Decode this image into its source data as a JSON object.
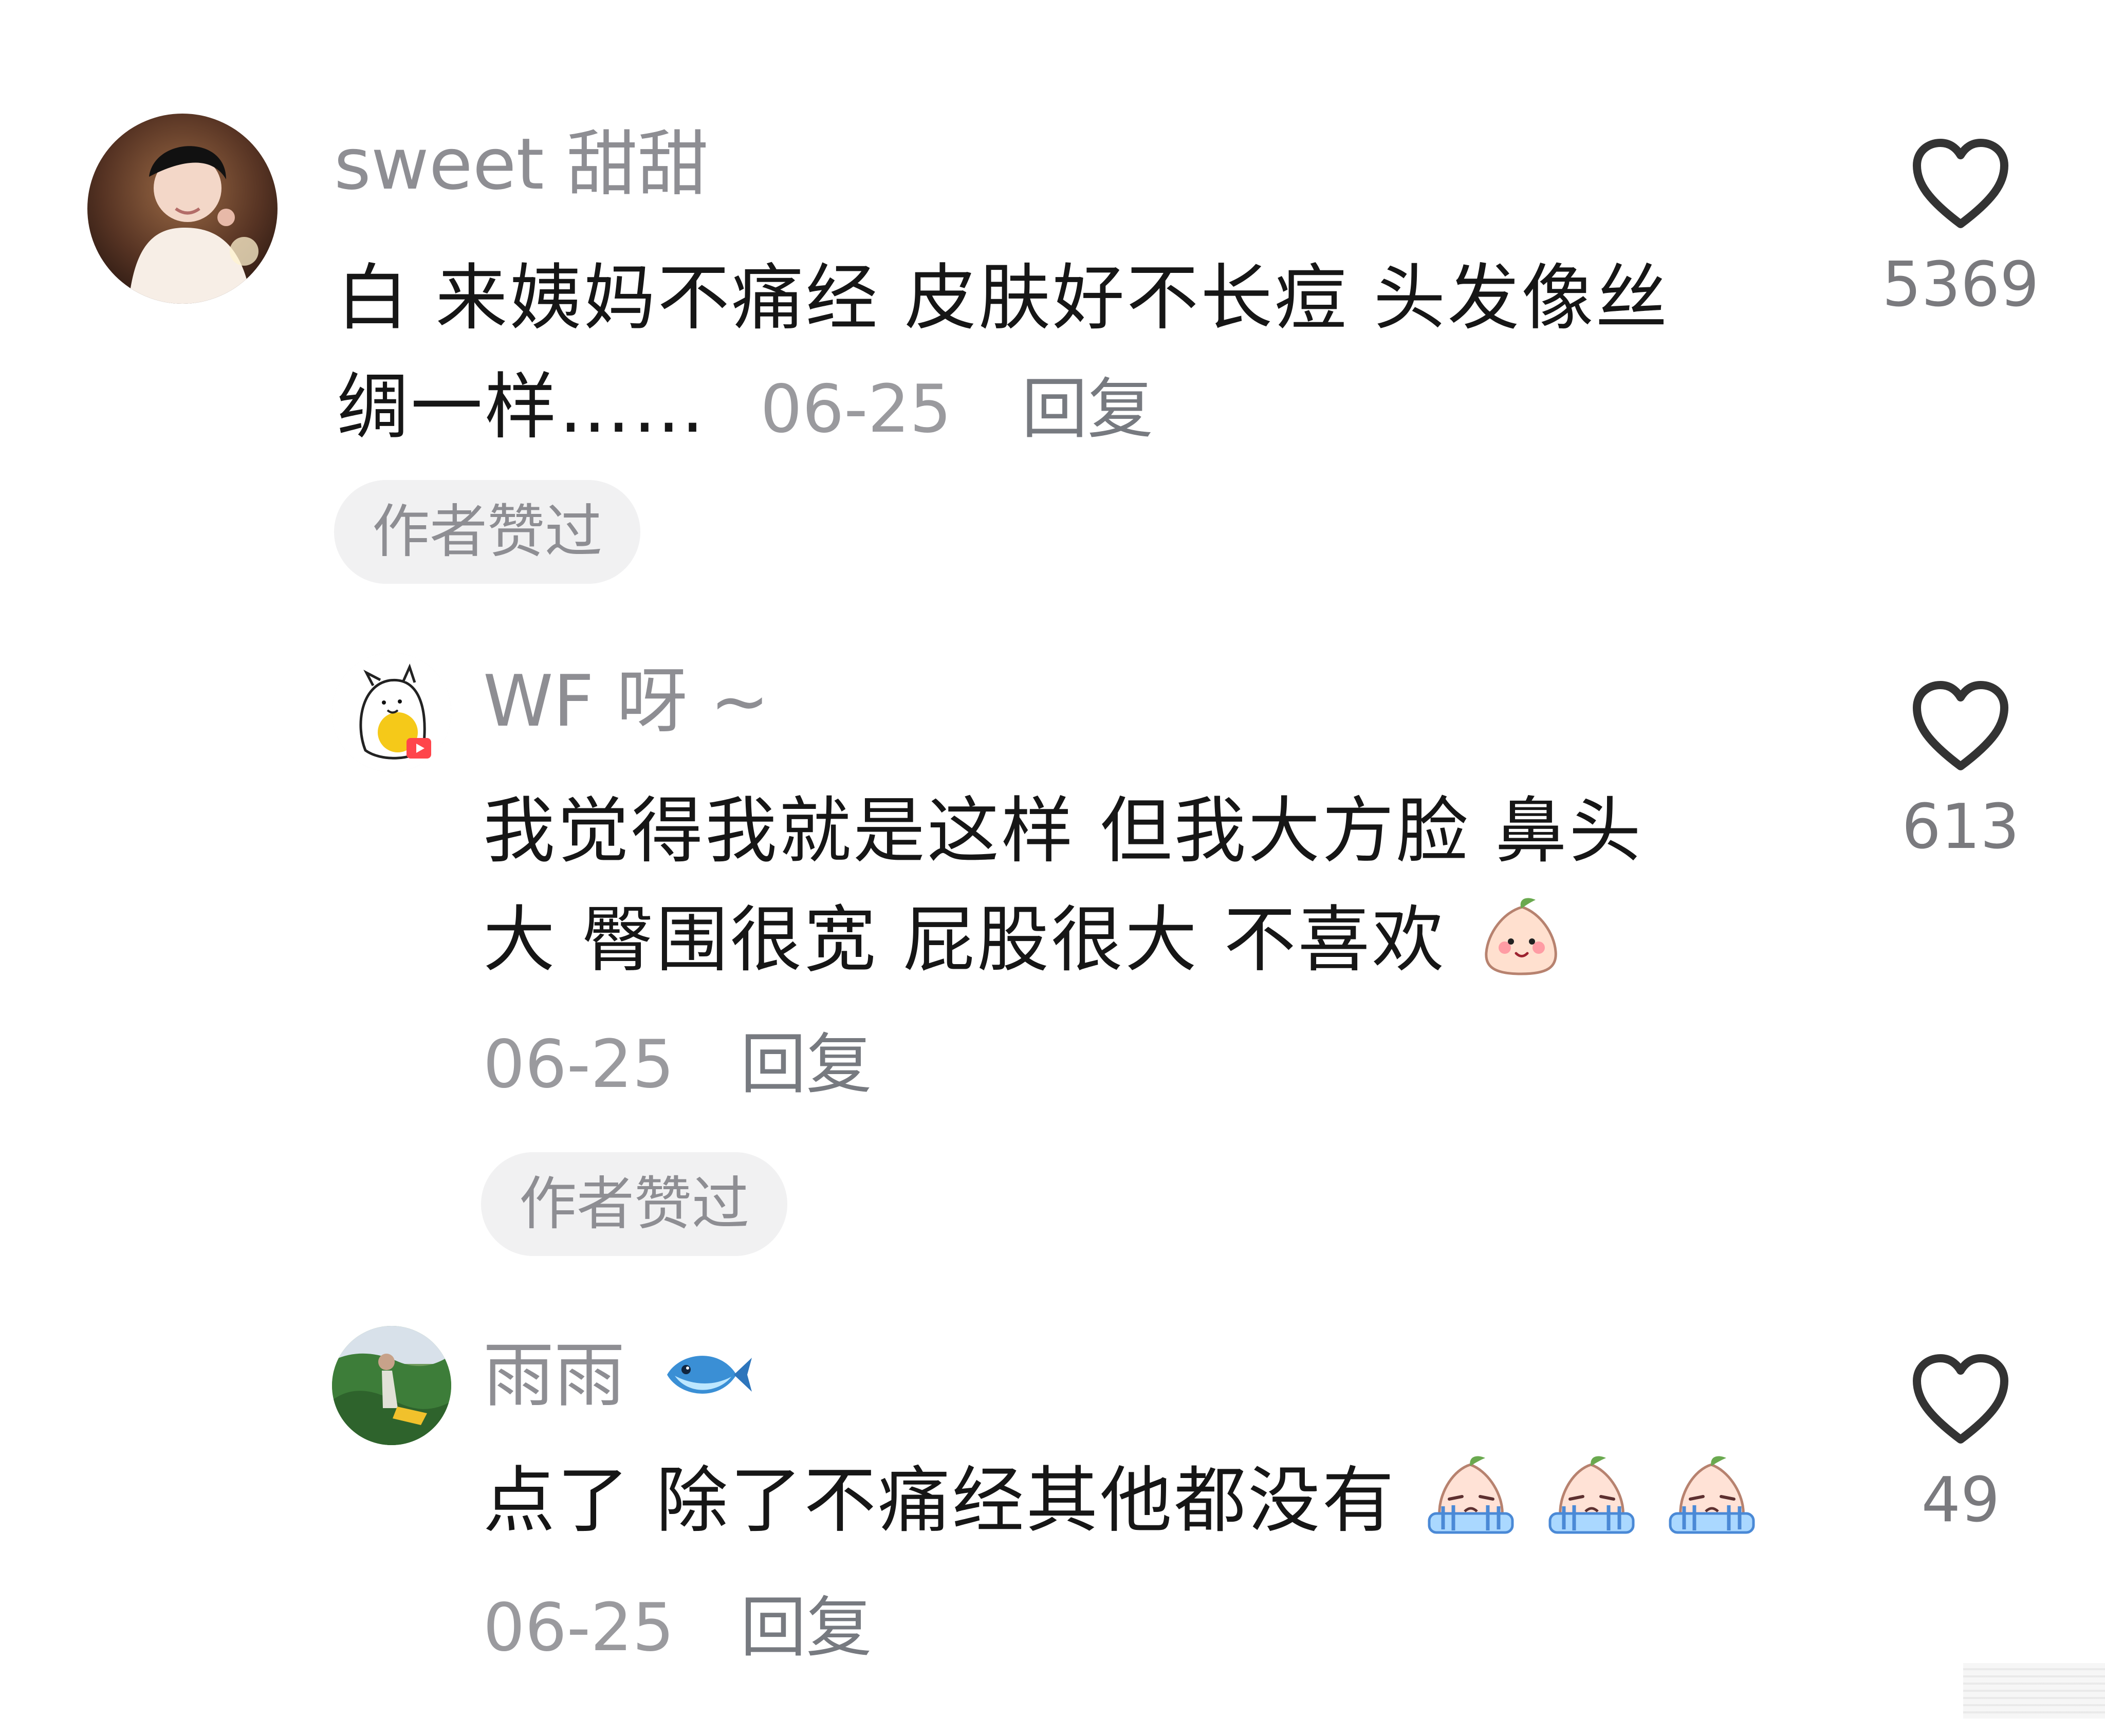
{
  "comments": [
    {
      "username": "sweet 甜甜",
      "text_line1": "白 来姨妈不痛经 皮肤好不长痘 头发像丝",
      "text_line2": "绸一样……",
      "date": "06-25",
      "reply": "回复",
      "badge": "作者赞过",
      "likes": "5369",
      "avatar_icon": "portrait-photo-avatar",
      "like_icon": "heart-outline-icon"
    },
    {
      "username": "WF 呀 ~",
      "text_line1": "我觉得我就是这样 但我大方脸  鼻头",
      "text_line2": "大 臀围很宽 屁股很大 不喜欢",
      "date": "06-25",
      "reply": "回复",
      "badge": "作者赞过",
      "likes": "613",
      "avatar_icon": "cartoon-cow-avatar",
      "emoji": "smiling-peach-emoji",
      "like_icon": "heart-outline-icon"
    },
    {
      "username": "雨雨",
      "username_emoji": "fish-emoji",
      "text": "点了 除了不痛经其他都没有",
      "date": "06-25",
      "reply": "回复",
      "likes": "49",
      "avatar_icon": "outdoor-person-avatar",
      "emoji": "crying-peach-emoji",
      "like_icon": "heart-outline-icon"
    }
  ],
  "colors": {
    "primary_text": "#161616",
    "secondary_text": "#8e8e93",
    "badge_background": "#f1f1f2"
  }
}
